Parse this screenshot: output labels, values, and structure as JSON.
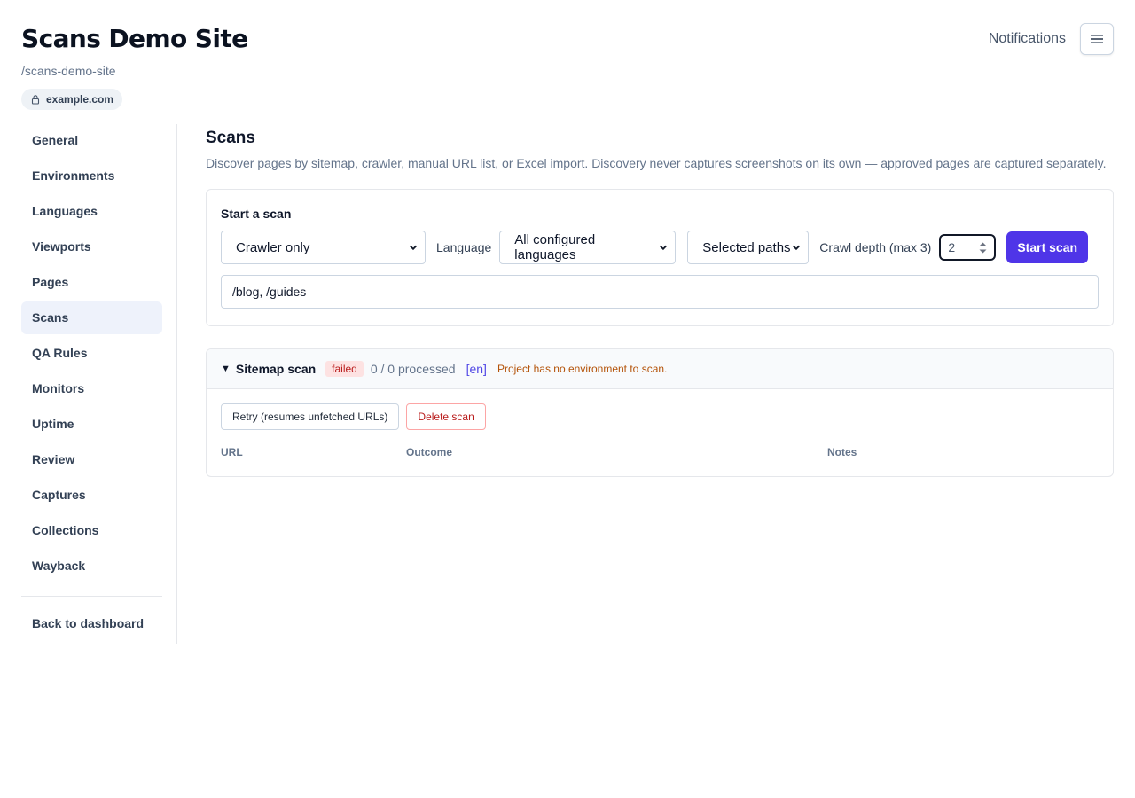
{
  "header": {
    "title": "Scans Demo Site",
    "slug": "/scans-demo-site",
    "domain": "example.com",
    "notifications_label": "Notifications",
    "menu_icon": "hamburger-icon"
  },
  "sidebar": {
    "items": [
      {
        "label": "General"
      },
      {
        "label": "Environments"
      },
      {
        "label": "Languages"
      },
      {
        "label": "Viewports"
      },
      {
        "label": "Pages"
      },
      {
        "label": "Scans",
        "active": true
      },
      {
        "label": "QA Rules"
      },
      {
        "label": "Monitors"
      },
      {
        "label": "Uptime"
      },
      {
        "label": "Review"
      },
      {
        "label": "Captures"
      },
      {
        "label": "Collections"
      },
      {
        "label": "Wayback"
      }
    ],
    "back_label": "Back to dashboard"
  },
  "main": {
    "title": "Scans",
    "description": "Discover pages by sitemap, crawler, manual URL list, or Excel import. Discovery never captures screenshots on its own — approved pages are captured separately.",
    "start_scan": {
      "heading": "Start a scan",
      "mode_value": "Crawler only",
      "language_label": "Language",
      "language_value": "All configured languages",
      "scope_value": "Selected paths",
      "depth_label": "Crawl depth (max 3)",
      "depth_value": "2",
      "start_button": "Start scan",
      "paths_value": "/blog, /guides"
    },
    "scan": {
      "name": "Sitemap scan",
      "status": "failed",
      "processed": "0 / 0 processed",
      "language": "[en]",
      "error": "Project has no environment to scan.",
      "retry_label": "Retry (resumes unfetched URLs)",
      "delete_label": "Delete scan",
      "columns": [
        "URL",
        "Outcome",
        "Notes"
      ]
    }
  },
  "colors": {
    "accent": "#4f35e8",
    "active_nav_bg": "#eef2fb",
    "failed_bg": "#fde2e2",
    "failed_text": "#b91c1c",
    "error_text": "#b45309"
  }
}
